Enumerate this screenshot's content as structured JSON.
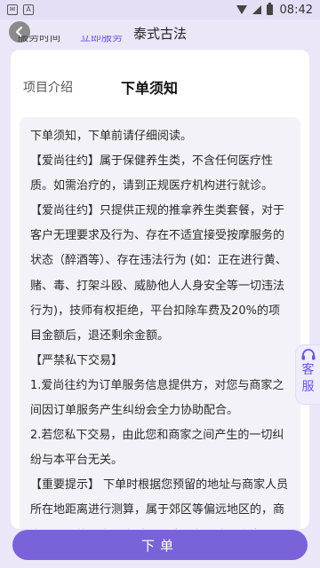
{
  "status_bar": {
    "time": "08:42",
    "left_icons": [
      "notification-icon",
      "text-icon"
    ]
  },
  "header": {
    "title": "泰式古法",
    "back_icon": "chevron-left-icon"
  },
  "prev_row": {
    "label": "服务时间",
    "value": "立即服务"
  },
  "tabs": [
    {
      "label": "项目介绍",
      "active": false
    },
    {
      "label": "下单须知",
      "active": true
    }
  ],
  "notice": {
    "paragraphs": [
      "下单须知，下单前请仔细阅读。",
      "【爱尚往约】属于保健养生类，不含任何医疗性质。如需治疗的，请到正规医疗机构进行就诊。",
      "【爱尚往约】只提供正规的推拿养生类套餐，对于客户无理要求及行为、存在不适宜接受按摩服务的状态（醉酒等）、存在违法行为 (如：正在进行黄、赌、毒、打架斗殴、威胁他人人身安全等一切违法行为)，技师有权拒绝，平台扣除车费及20%的项目金额后，退还剩余金额。",
      "【严禁私下交易】",
      "1.爱尚往约为订单服务信息提供方，对您与商家之间因订单服务产生纠纷会全力协助配合。",
      "2.若您私下交易，由此您和商家之间产生的一切纠纷与本平台无关。",
      "【重要提示】 下单时根据您预留的地址与商家人员所在地距离进行测算，属于郊区等偏远地区的，商家人员可能因为距离过远无法服务，我们会电话通知您，并将实付款项按照原路退回。"
    ]
  },
  "customer_service": {
    "label_line1": "客",
    "label_line2": "服",
    "icon": "headset-icon"
  },
  "order_button": {
    "label": "下单"
  },
  "colors": {
    "accent": "#7a63d9",
    "background": "#ebe7f8",
    "tab_highlight": "#c9bdf5"
  }
}
